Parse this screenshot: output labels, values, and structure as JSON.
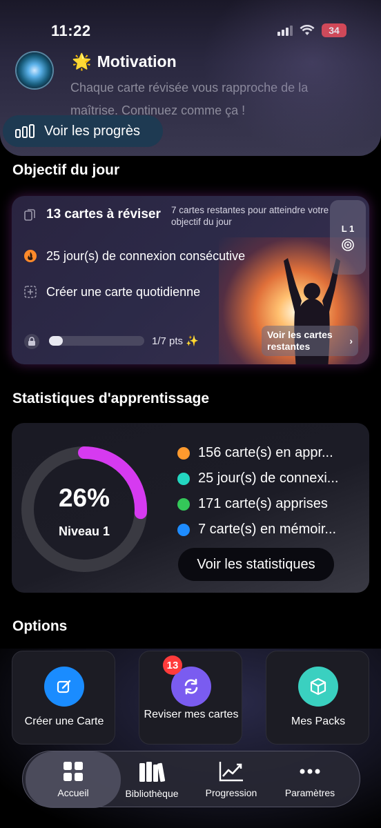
{
  "status": {
    "time": "11:22",
    "battery": "34"
  },
  "motivation": {
    "emoji": "🌟",
    "title": "Motivation",
    "text": "Chaque carte révisée vous rapproche de la maîtrise. Continuez comme ça !",
    "progress_button": "Voir les progrès"
  },
  "daily_goal": {
    "section_title": "Objectif du jour",
    "cards_to_review": "13 cartes à réviser",
    "hint": "7 cartes restantes pour atteindre votre objectif du jour",
    "streak": "25 jour(s) de connexion consécutive",
    "create_card": "Créer une carte quotidienne",
    "level": "L 1",
    "points_text": "1/7 pts ✨",
    "points_fraction": 0.143,
    "see_remaining": "Voir les cartes restantes"
  },
  "stats": {
    "section_title": "Statistiques d'apprentissage",
    "percent_label": "26%",
    "percent": 26,
    "level_label": "Niveau 1",
    "legend": [
      {
        "text": "156 carte(s) en appr...",
        "color": "#ff9a2e"
      },
      {
        "text": "25 jour(s) de connexi...",
        "color": "#23d6c0"
      },
      {
        "text": "171 carte(s) apprises",
        "color": "#34c759"
      },
      {
        "text": "7 carte(s) en mémoir...",
        "color": "#1e8cff"
      }
    ],
    "see_stats": "Voir les statistiques",
    "ring_color": "#d63af0"
  },
  "options": {
    "section_title": "Options",
    "items": [
      {
        "label": "Créer une Carte",
        "color": "#1a8cff",
        "icon": "edit-icon"
      },
      {
        "label": "Reviser mes cartes",
        "color": "#7a5cf0",
        "icon": "refresh-icon",
        "badge": "13"
      },
      {
        "label": "Mes Packs",
        "color": "#3ad0c0",
        "icon": "package-icon"
      }
    ]
  },
  "tabbar": {
    "tabs": [
      {
        "label": "Accueil",
        "icon": "grid-icon",
        "active": true
      },
      {
        "label": "Bibliothèque",
        "icon": "books-icon"
      },
      {
        "label": "Progression",
        "icon": "chart-icon"
      },
      {
        "label": "Paramètres",
        "icon": "more-icon"
      }
    ]
  }
}
